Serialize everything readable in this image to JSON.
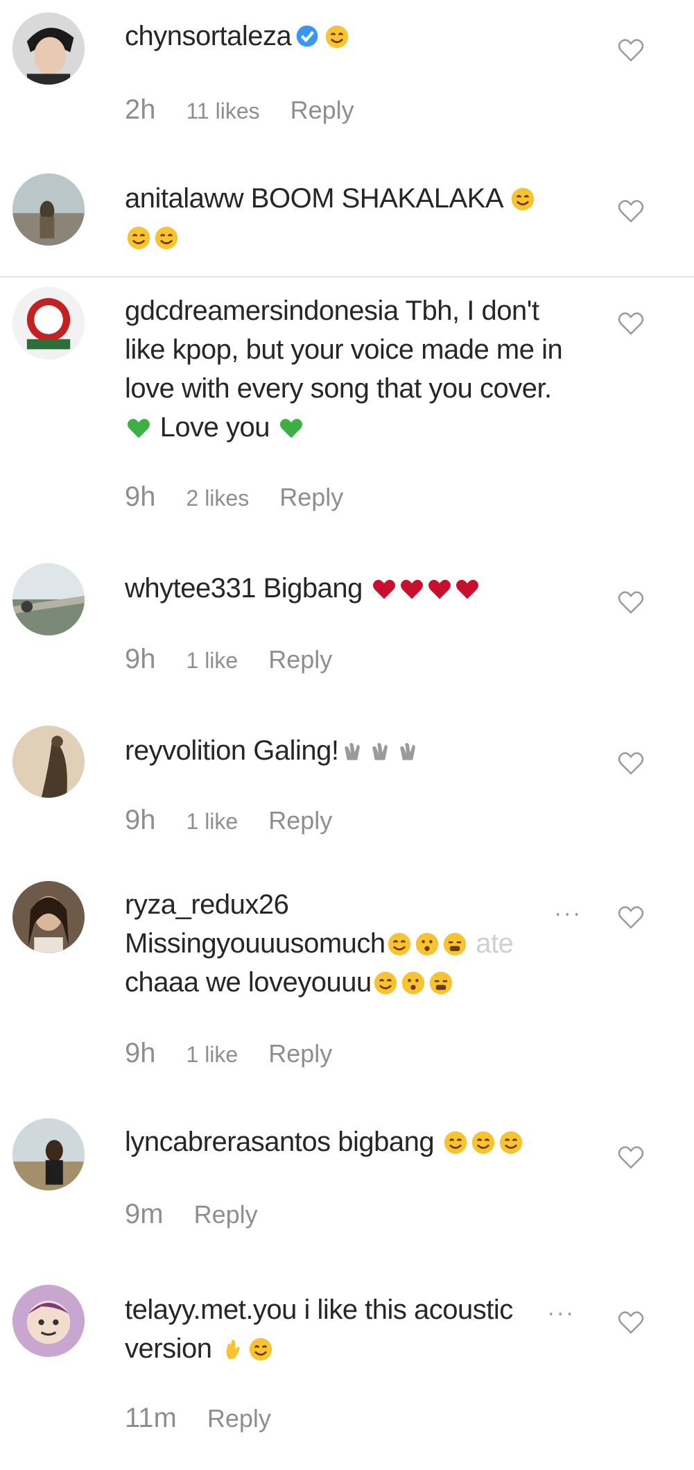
{
  "comments": [
    {
      "username": "chynsortaleza",
      "verified": true,
      "text": "",
      "emojis": [
        "smile-emoji"
      ],
      "time": "2h",
      "likes": "11 likes",
      "reply": "Reply"
    },
    {
      "username": "anitalaww",
      "text": "BOOM SHAKALAKA",
      "emojis": [
        "smile-emoji",
        "smile-emoji",
        "smile-emoji"
      ],
      "time": "",
      "likes": "",
      "reply": ""
    },
    {
      "username": "gdcdreamersindonesia",
      "text": "Tbh, I don't like kpop, but your voice made me in love with every song that you cover.",
      "text_after": "Love you",
      "emojis": [
        "green-heart-emoji",
        "green-heart-emoji"
      ],
      "time": "9h",
      "likes": "2 likes",
      "reply": "Reply"
    },
    {
      "username": "whytee331",
      "text": "Bigbang",
      "emojis": [
        "red-heart-emoji",
        "red-heart-emoji",
        "red-heart-emoji",
        "red-heart-emoji"
      ],
      "time": "9h",
      "likes": "1 like",
      "reply": "Reply"
    },
    {
      "username": "reyvolition",
      "text": "Galing!",
      "emojis": [
        "clap-emoji",
        "clap-emoji",
        "clap-emoji"
      ],
      "time": "9h",
      "likes": "1 like",
      "reply": "Reply"
    },
    {
      "username": "ryza_redux26",
      "text": "Missingyouuusomuch",
      "text_tail": "ate",
      "text_line2": "chaaa we loveyouuu",
      "emojis": [
        "smile-emoji",
        "kiss-emoji",
        "cry-emoji"
      ],
      "time": "9h",
      "likes": "1 like",
      "reply": "Reply"
    },
    {
      "username": "lyncabrerasantos",
      "text": "bigbang",
      "emojis": [
        "smile-emoji",
        "smile-emoji",
        "smile-emoji"
      ],
      "time": "9m",
      "likes": "",
      "reply": "Reply"
    },
    {
      "username": "telayy.met.you",
      "text": "i like this acoustic",
      "text_line2": "version",
      "emojis": [
        "hand-emoji",
        "smile-emoji"
      ],
      "time": "11m",
      "likes": "",
      "reply": "Reply"
    }
  ],
  "more_label": "...",
  "colors": {
    "text": "#262626",
    "meta": "#8e8e8e",
    "verified": "#3897f0",
    "emoji_yellow": "#f7c331",
    "green_heart": "#3cb043",
    "red_heart": "#c8102e"
  }
}
